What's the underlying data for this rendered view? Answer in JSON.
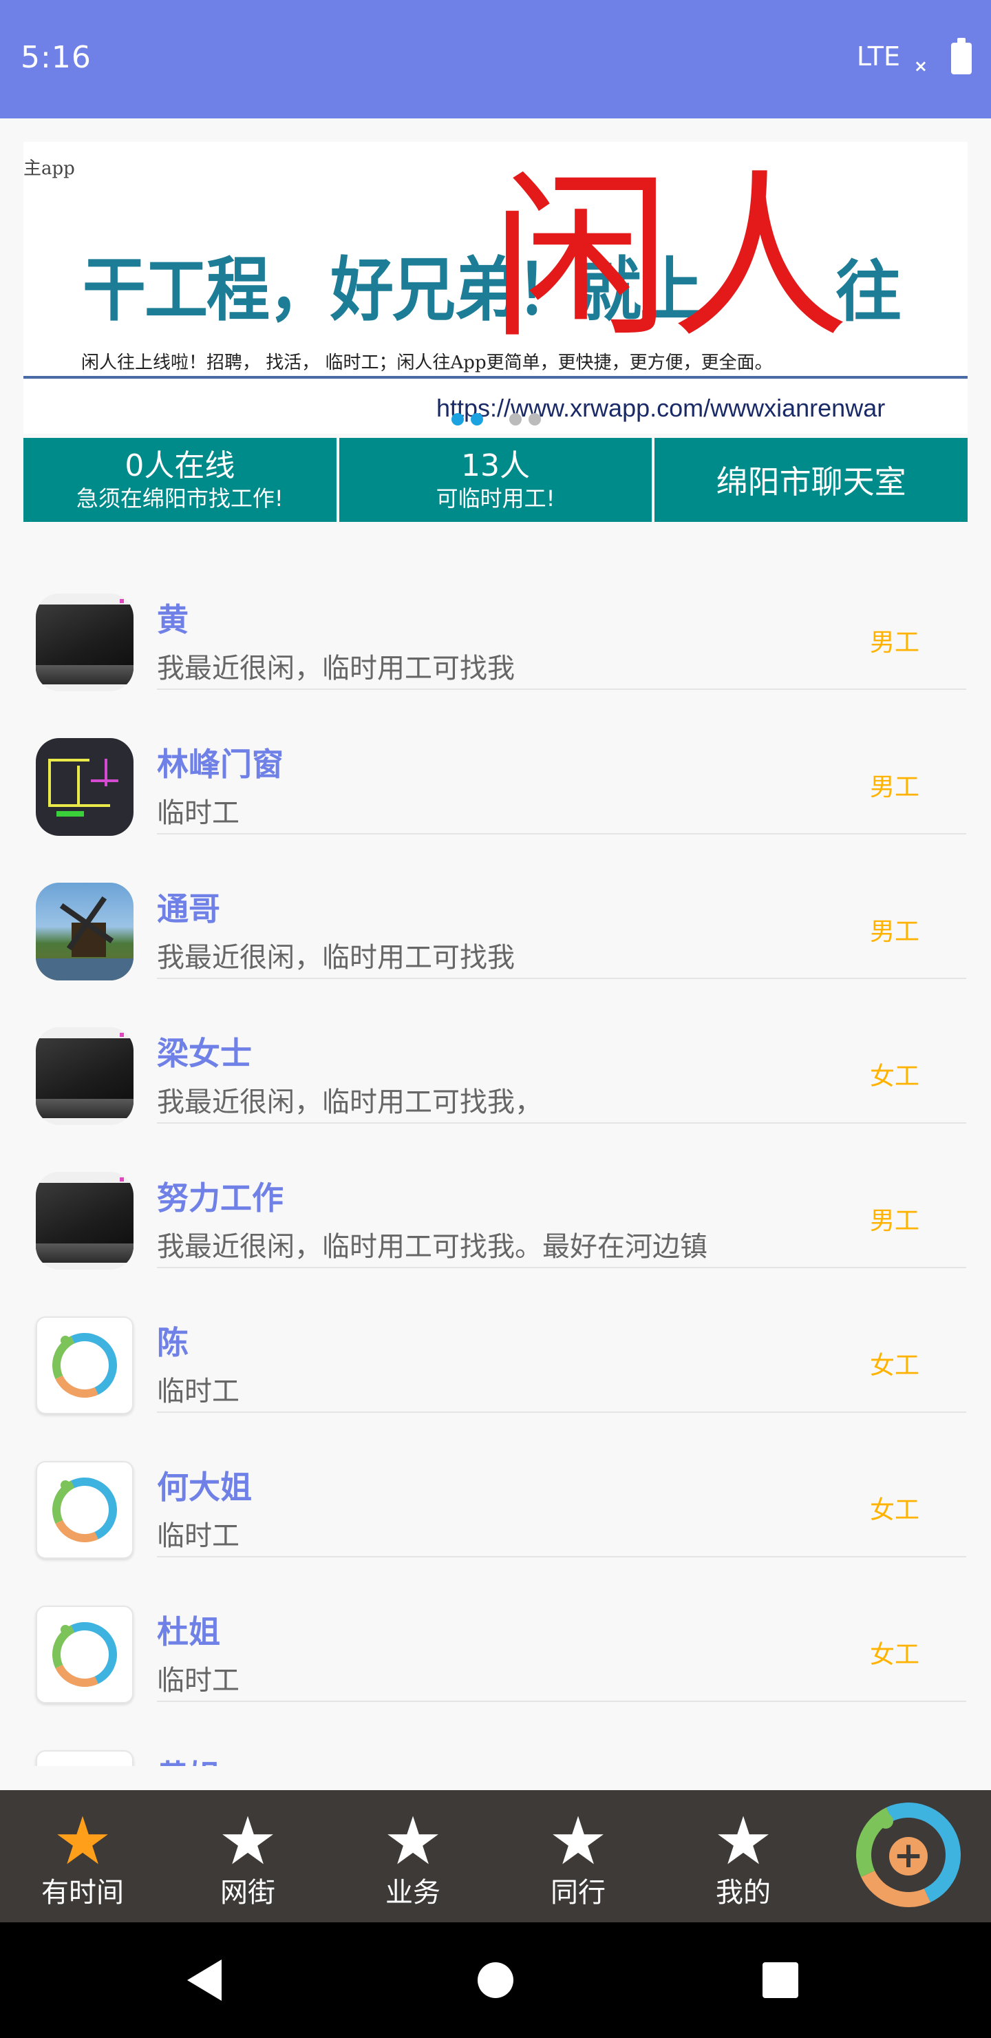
{
  "status": {
    "time": "5:16",
    "network": "LTE",
    "signal_mark": "×"
  },
  "banner": {
    "app_text": "主app",
    "slogan": "干工程，好兄弟！就上",
    "big_text": "闲人",
    "wang_text": "往",
    "desc": "闲人往上线啦！招聘， 找活， 临时工；闲人往App更简单，更快捷，更方便，更全面。",
    "url": "https://www.xrwapp.com/wwwxianrenwar",
    "dot_active": "#1aa3e0",
    "dot_inactive": "#bbbbbb"
  },
  "info": {
    "online_main": "0人在线",
    "online_sub": "急须在绵阳市找工作!",
    "workers_main": "13人",
    "workers_sub": "可临时用工!",
    "chatroom": "绵阳市聊天室"
  },
  "list": [
    {
      "name": "黄",
      "desc": "我最近很闲，临时用工可找我",
      "gender": "男工",
      "avatar": "laptop-avatar"
    },
    {
      "name": "林峰门窗",
      "desc": "临时工",
      "gender": "男工",
      "avatar": "floorplan-avatar"
    },
    {
      "name": "通哥",
      "desc": "我最近很闲，临时用工可找我",
      "gender": "男工",
      "avatar": "windmill-avatar"
    },
    {
      "name": "梁女士",
      "desc": "我最近很闲，临时用工可找我，",
      "gender": "女工",
      "avatar": "laptop-avatar"
    },
    {
      "name": "努力工作",
      "desc": "我最近很闲，临时用工可找我。最好在河边镇",
      "gender": "男工",
      "avatar": "laptop-avatar"
    },
    {
      "name": "陈",
      "desc": "临时工",
      "gender": "女工",
      "avatar": "app-logo-avatar"
    },
    {
      "name": "何大姐",
      "desc": "临时工",
      "gender": "女工",
      "avatar": "app-logo-avatar"
    },
    {
      "name": "杜姐",
      "desc": "临时工",
      "gender": "女工",
      "avatar": "app-logo-avatar"
    },
    {
      "name": "黄姐",
      "desc": "",
      "gender": "",
      "avatar": "app-logo-avatar"
    }
  ],
  "bottom_nav": {
    "items": [
      {
        "label": "有时间",
        "active": true
      },
      {
        "label": "网街",
        "active": false
      },
      {
        "label": "业务",
        "active": false
      },
      {
        "label": "同行",
        "active": false
      },
      {
        "label": "我的",
        "active": false
      }
    ],
    "star_active_color": "#ff9f1a",
    "star_inactive_color": "#ffffff",
    "fab_symbol": "+"
  }
}
